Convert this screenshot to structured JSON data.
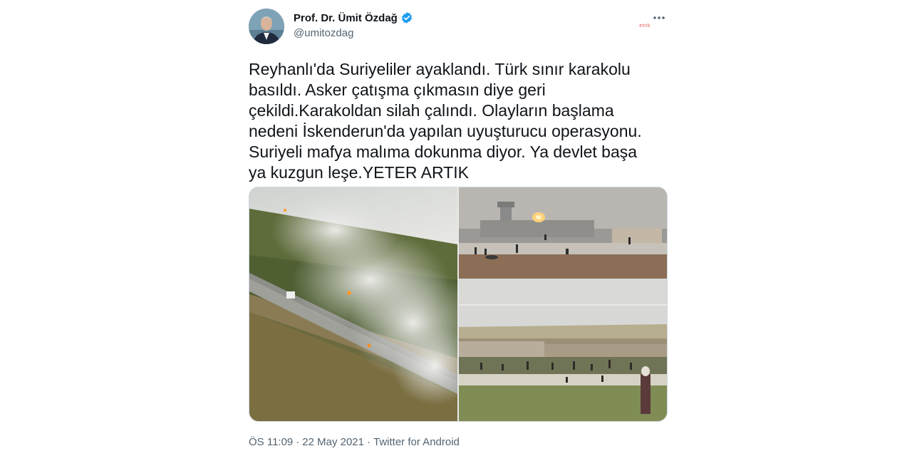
{
  "author": {
    "display_name": "Prof. Dr. Ümit Özdağ",
    "handle": "@umitozdag",
    "verified_icon": "verified-badge-icon",
    "badge_color": "#1d9bf0"
  },
  "more_icon": "more-dots-icon",
  "watermark": "etrik",
  "tweet_text": "Reyhanlı'da Suriyeliler ayaklandı. Türk sınır karakolu\nbasıldı. Asker çatışma çıkmasın diye geri\nçekildi.Karakoldan silah çalındı. Olayların başlama\nnedeni İskenderun'da yapılan uyuşturucu operasyonu.\nSuriyeli mafya malıma dokunma diyor. Ya devlet başa\nya kuzgun leşe.YETER ARTIK",
  "media": {
    "photos": [
      "border-fire-photo",
      "border-post-crowd-photo",
      "crowd-field-photo"
    ]
  },
  "meta": {
    "time": "ÖS 11:09",
    "separator1": "·",
    "date": "22 May 2021",
    "separator2": "·",
    "source": "Twitter for Android"
  }
}
